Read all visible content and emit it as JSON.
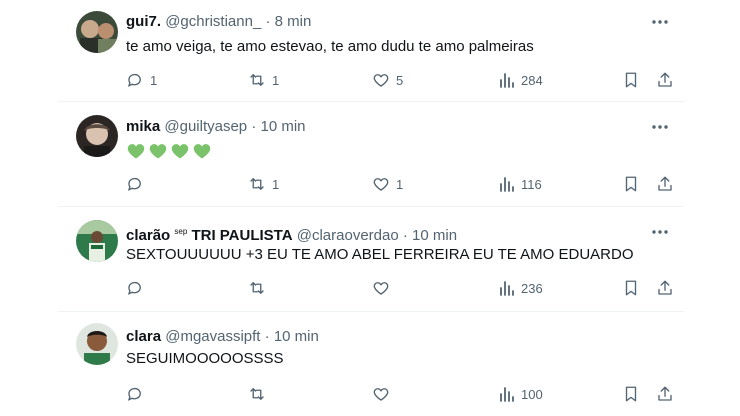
{
  "colors": {
    "text": "#0f1419",
    "muted": "#536471",
    "divider": "#eff3f4",
    "heart": "#7ac36a"
  },
  "posts": [
    {
      "name": "gui7.",
      "name_tag": "",
      "name_suffix": "",
      "handle": "@gchristiann_",
      "dot": "·",
      "time": "8 min",
      "text": "te amo veiga, te amo estevao, te amo dudu te amo palmeiras",
      "replies": "1",
      "reposts": "1",
      "likes": "5",
      "views": "284"
    },
    {
      "name": "mika",
      "name_tag": "",
      "name_suffix": "",
      "handle": "@guiltyasep",
      "dot": "·",
      "time": "10 min",
      "text": "",
      "emoji": [
        "green-heart",
        "green-heart",
        "green-heart",
        "green-heart"
      ],
      "replies": "",
      "reposts": "1",
      "likes": "1",
      "views": "116"
    },
    {
      "name": "clarão",
      "name_tag": "sep",
      "name_suffix": "TRI PAULISTA",
      "handle": "@claraoverdao",
      "dot": "·",
      "time": "10 min",
      "text": "SEXTOUUUUUU +3 EU TE AMO ABEL FERREIRA EU TE AMO EDUARDO",
      "replies": "",
      "reposts": "",
      "likes": "",
      "views": "236"
    },
    {
      "name": "clara",
      "name_tag": "",
      "name_suffix": "",
      "handle": "@mgavassipft",
      "dot": "·",
      "time": "10 min",
      "text": "SEGUIMOOOOOSSSS",
      "replies": "",
      "reposts": "",
      "likes": "",
      "views": "100"
    }
  ],
  "icons": {
    "reply": "reply-icon",
    "repost": "repost-icon",
    "like": "heart-icon",
    "views": "views-icon",
    "bookmark": "bookmark-icon",
    "share": "share-icon",
    "more": "more-icon"
  }
}
